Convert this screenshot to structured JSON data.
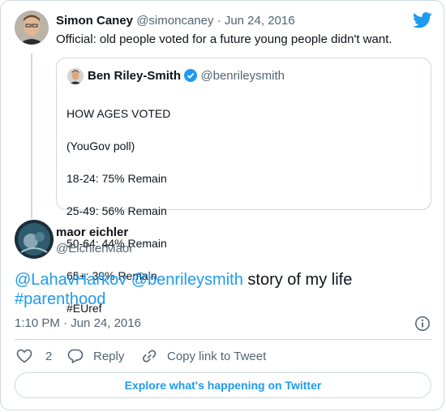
{
  "original_tweet": {
    "author_name": "Simon Caney",
    "author_handle": "@simoncaney",
    "date": "Jun 24, 2016",
    "separator": "·",
    "text": "Official: old people voted for a future young people didn't want."
  },
  "quoted_tweet": {
    "author_name": "Ben Riley-Smith",
    "author_handle": "@benrileysmith",
    "lines": [
      "HOW AGES VOTED",
      "(YouGov poll)",
      "18-24: 75% Remain",
      "25-49: 56% Remain",
      "50-64: 44% Remain",
      "65+: 39% Remain",
      "#EUref"
    ]
  },
  "reply": {
    "author_name": "maor eichler",
    "author_handle": "@EichlerMaor",
    "mention_1": "@LahavHarkov",
    "mention_2": "@benrileysmith",
    "text": "story of my life",
    "hashtag": "#parenthood",
    "time": "1:10 PM",
    "date": "Jun 24, 2016",
    "separator": "·"
  },
  "actions": {
    "like_count": "2",
    "reply_label": "Reply",
    "copy_link_label": "Copy link to Tweet"
  },
  "explore_label": "Explore what's happening on Twitter",
  "icons": {
    "brand": "twitter-bird-icon",
    "info": "info-icon",
    "like": "heart-icon",
    "reply": "speech-bubble-icon",
    "copy": "link-icon",
    "verified": "verified-badge-icon"
  },
  "colors": {
    "accent": "#1d9bf0",
    "text": "#0f1419",
    "muted": "#536471",
    "border": "#cfd9de"
  }
}
